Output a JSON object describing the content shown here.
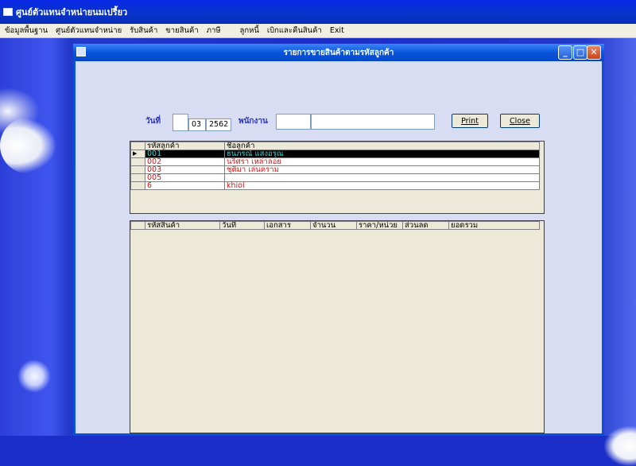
{
  "app": {
    "title": "ศูนย์ตัวแทนจำหน่ายนมเปรี้ยว"
  },
  "menu": [
    "ข้อมูลพื้นฐาน",
    "ศูนย์ตัวแทนจำหน่าย",
    "รับสินค้า",
    "ขายสินค้า",
    "ภาษี",
    "ลูกหนี้",
    "เบิกและคืนสินค้า",
    "Exit"
  ],
  "window": {
    "title": "รายการขายสินค้าตามรหัสลูกค้า"
  },
  "form": {
    "date_label": "วันที่",
    "day_value": "",
    "month_value": "03",
    "year_value": "2562",
    "employee_label": "พนักงาน",
    "employee_code": "",
    "employee_name": "",
    "print_label": "Print",
    "close_label": "Close"
  },
  "customers": {
    "headers": [
      "รหัสลูกค้า",
      "ชื่อลูกค้า"
    ],
    "rows": [
      {
        "code": "001",
        "name": "ธนภรณ์  แสงอรุณ",
        "selected": true
      },
      {
        "code": "002",
        "name": "นริศรา  เหล่าลอย",
        "selected": false
      },
      {
        "code": "003",
        "name": "ชุติมา  เล่นคราม",
        "selected": false
      },
      {
        "code": "005",
        "name": "",
        "selected": false
      },
      {
        "code": "6",
        "name": "khiol",
        "selected": false
      }
    ]
  },
  "sales": {
    "headers": [
      "รหัสสินค้า",
      "วันที่",
      "เอกสาร",
      "จำนวน",
      "ราคา/หน่วย",
      "ส่วนลด",
      "ยอดรวม"
    ]
  },
  "colors": {
    "title_bar": "#0855dd",
    "accent_text": "#2a34c0",
    "row_text": "#e01010",
    "selected_text": "#33d6d6"
  }
}
